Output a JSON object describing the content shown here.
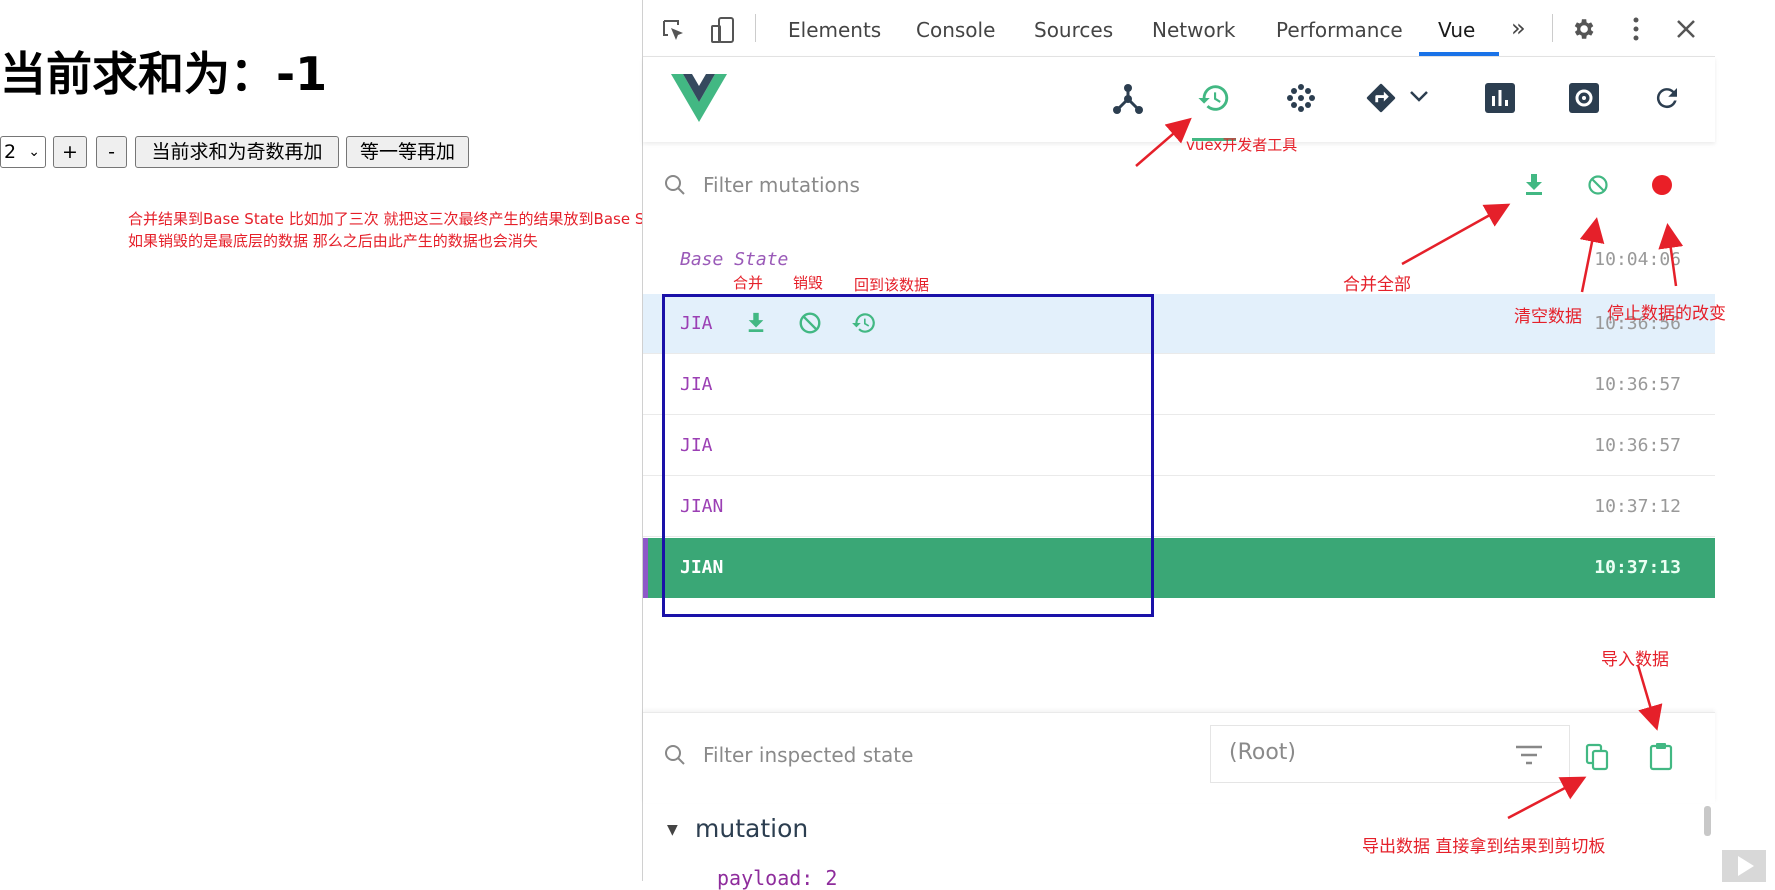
{
  "app": {
    "heading": "当前求和为：-1",
    "select_value": "2",
    "buttons": {
      "increment": "+",
      "decrement": "-",
      "increment_if_odd": "当前求和为奇数再加",
      "increment_wait": "等一等再加"
    }
  },
  "notes": {
    "line1": "合并结果到Base State 比如加了三次 就把这三次最终产生的结果放到Base State",
    "line2": "如果销毁的是最底层的数据 那么之后由此产生的数据也会消失",
    "merge": "合并",
    "destroy": "销毁",
    "revert": "回到该数据",
    "vuex_tools": "vuex开发者工具",
    "commit_all": "合并全部",
    "clear": "清空数据",
    "stop": "停止数据的改变",
    "import": "导入数据",
    "export": "导出数据 直接拿到结果到剪切板"
  },
  "devtools": {
    "tabs": [
      "Elements",
      "Console",
      "Sources",
      "Network",
      "Performance",
      "Vue"
    ],
    "active_tab": "Vue",
    "more": "»",
    "filter_mutations_placeholder": "Filter mutations",
    "base_state": {
      "label": "Base State",
      "time": "10:04:06"
    },
    "mutations": [
      {
        "name": "JIA",
        "time": "10:36:56",
        "state": "hover"
      },
      {
        "name": "JIA",
        "time": "10:36:57",
        "state": "normal"
      },
      {
        "name": "JIA",
        "time": "10:36:57",
        "state": "normal"
      },
      {
        "name": "JIAN",
        "time": "10:37:12",
        "state": "normal"
      },
      {
        "name": "JIAN",
        "time": "10:37:13",
        "state": "selected"
      }
    ],
    "filter_state_placeholder": "Filter inspected state",
    "root_select": "(Root)",
    "mutation_section": "mutation",
    "payload_line": "payload: 2"
  },
  "colors": {
    "vue_green": "#42b883",
    "selected_row": "#3aa776",
    "annotation_red": "#e5202a",
    "box_blue": "#1a11a8"
  },
  "icons": [
    "select-element-icon",
    "device-toggle-icon",
    "settings-gear-icon",
    "kebab-menu-icon",
    "close-icon",
    "vue-logo-icon",
    "component-tree-icon",
    "vuex-history-icon",
    "events-icon",
    "router-icon",
    "performance-icon",
    "vue-settings-icon",
    "refresh-icon",
    "search-icon",
    "commit-all-icon",
    "clear-icon",
    "record-icon",
    "filter-icon",
    "copy-icon",
    "paste-icon",
    "play-icon"
  ]
}
